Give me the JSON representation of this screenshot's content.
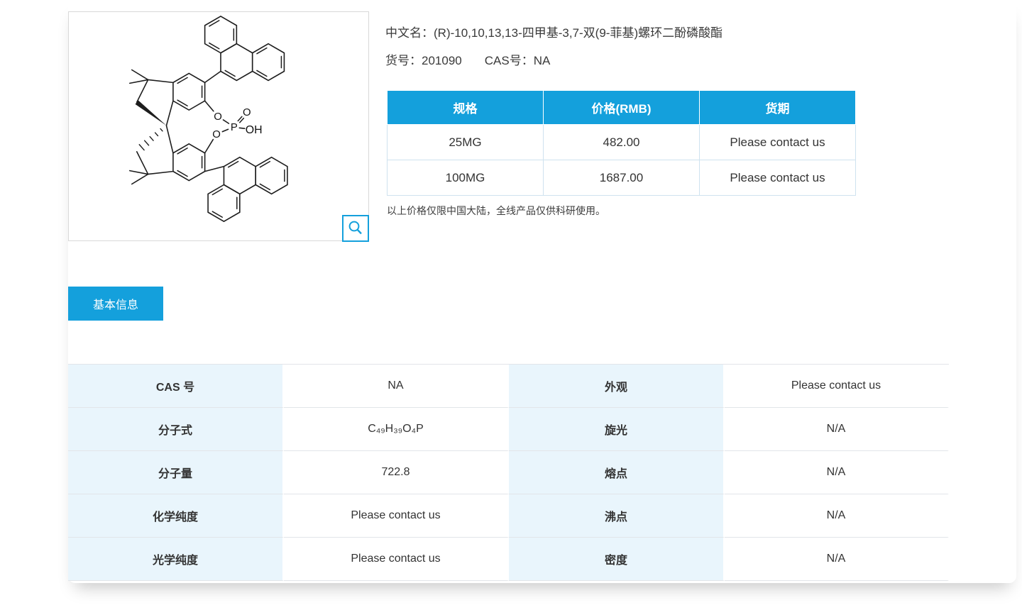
{
  "product": {
    "name_label": "中文名：",
    "name": "(R)-10,10,13,13-四甲基-3,7-双(9-菲基)螺环二酚磷酸酯",
    "item_no_label": "货号：",
    "item_no": "201090",
    "cas_label": "CAS号：",
    "cas": "NA"
  },
  "structure_image": {
    "description": "黑白骨架结构式：螺环双茚满骨架（含四个甲基），环状磷酸酯 O-P(=O)(OH)-O 桥，3,7-位连接两个9-菲基",
    "atom_labels": [
      "O",
      "O",
      "P",
      "O",
      "OH"
    ]
  },
  "pricing_table": {
    "headers": [
      "规格",
      "价格(RMB)",
      "货期"
    ],
    "rows": [
      {
        "spec": "25MG",
        "price": "482.00",
        "delivery": "Please contact us"
      },
      {
        "spec": "100MG",
        "price": "1687.00",
        "delivery": "Please contact us"
      }
    ],
    "note": "以上价格仅限中国大陆，全线产品仅供科研使用。"
  },
  "tabs": {
    "basic_info": "基本信息"
  },
  "info_table": {
    "rows": [
      {
        "label1": "CAS 号",
        "value1": "NA",
        "label2": "外观",
        "value2": "Please contact us"
      },
      {
        "label1": "分子式",
        "value1": "C₄₉H₃₉O₄P",
        "label2": "旋光",
        "value2": "N/A"
      },
      {
        "label1": "分子量",
        "value1": "722.8",
        "label2": "熔点",
        "value2": "N/A"
      },
      {
        "label1": "化学纯度",
        "value1": "Please contact us",
        "label2": "沸点",
        "value2": "N/A"
      },
      {
        "label1": "光学纯度",
        "value1": "Please contact us",
        "label2": "密度",
        "value2": "N/A"
      }
    ]
  },
  "colors": {
    "accent_blue": "#14a0dc",
    "label_cell_bg": "#e9f5fc"
  }
}
